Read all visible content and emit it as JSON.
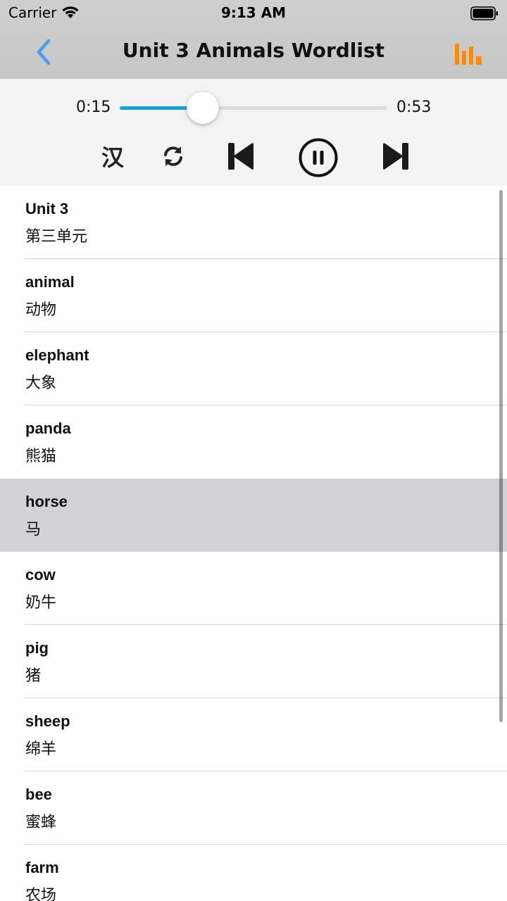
{
  "status_bar": {
    "carrier": "Carrier",
    "time": "9:13 AM"
  },
  "nav": {
    "title": "Unit 3 Animals Wordlist",
    "back_icon": "chevron-left-icon",
    "stats_icon": "bar-chart-icon",
    "accent_color": "#4a9fe8",
    "stats_color": "#ff8a00"
  },
  "player": {
    "current_time": "0:15",
    "total_time": "0:53",
    "progress": 0.31,
    "language_toggle": "汉",
    "progress_color": "#1a9ee6"
  },
  "words": [
    {
      "word": "Unit 3",
      "meaning": "第三单元"
    },
    {
      "word": "animal",
      "meaning": "动物"
    },
    {
      "word": "elephant",
      "meaning": "大象"
    },
    {
      "word": "panda",
      "meaning": "熊猫"
    },
    {
      "word": "horse",
      "meaning": "马",
      "selected": true
    },
    {
      "word": "cow",
      "meaning": "奶牛"
    },
    {
      "word": "pig",
      "meaning": "猪"
    },
    {
      "word": "sheep",
      "meaning": "绵羊"
    },
    {
      "word": "bee",
      "meaning": "蜜蜂"
    },
    {
      "word": "farm",
      "meaning": "农场"
    }
  ]
}
